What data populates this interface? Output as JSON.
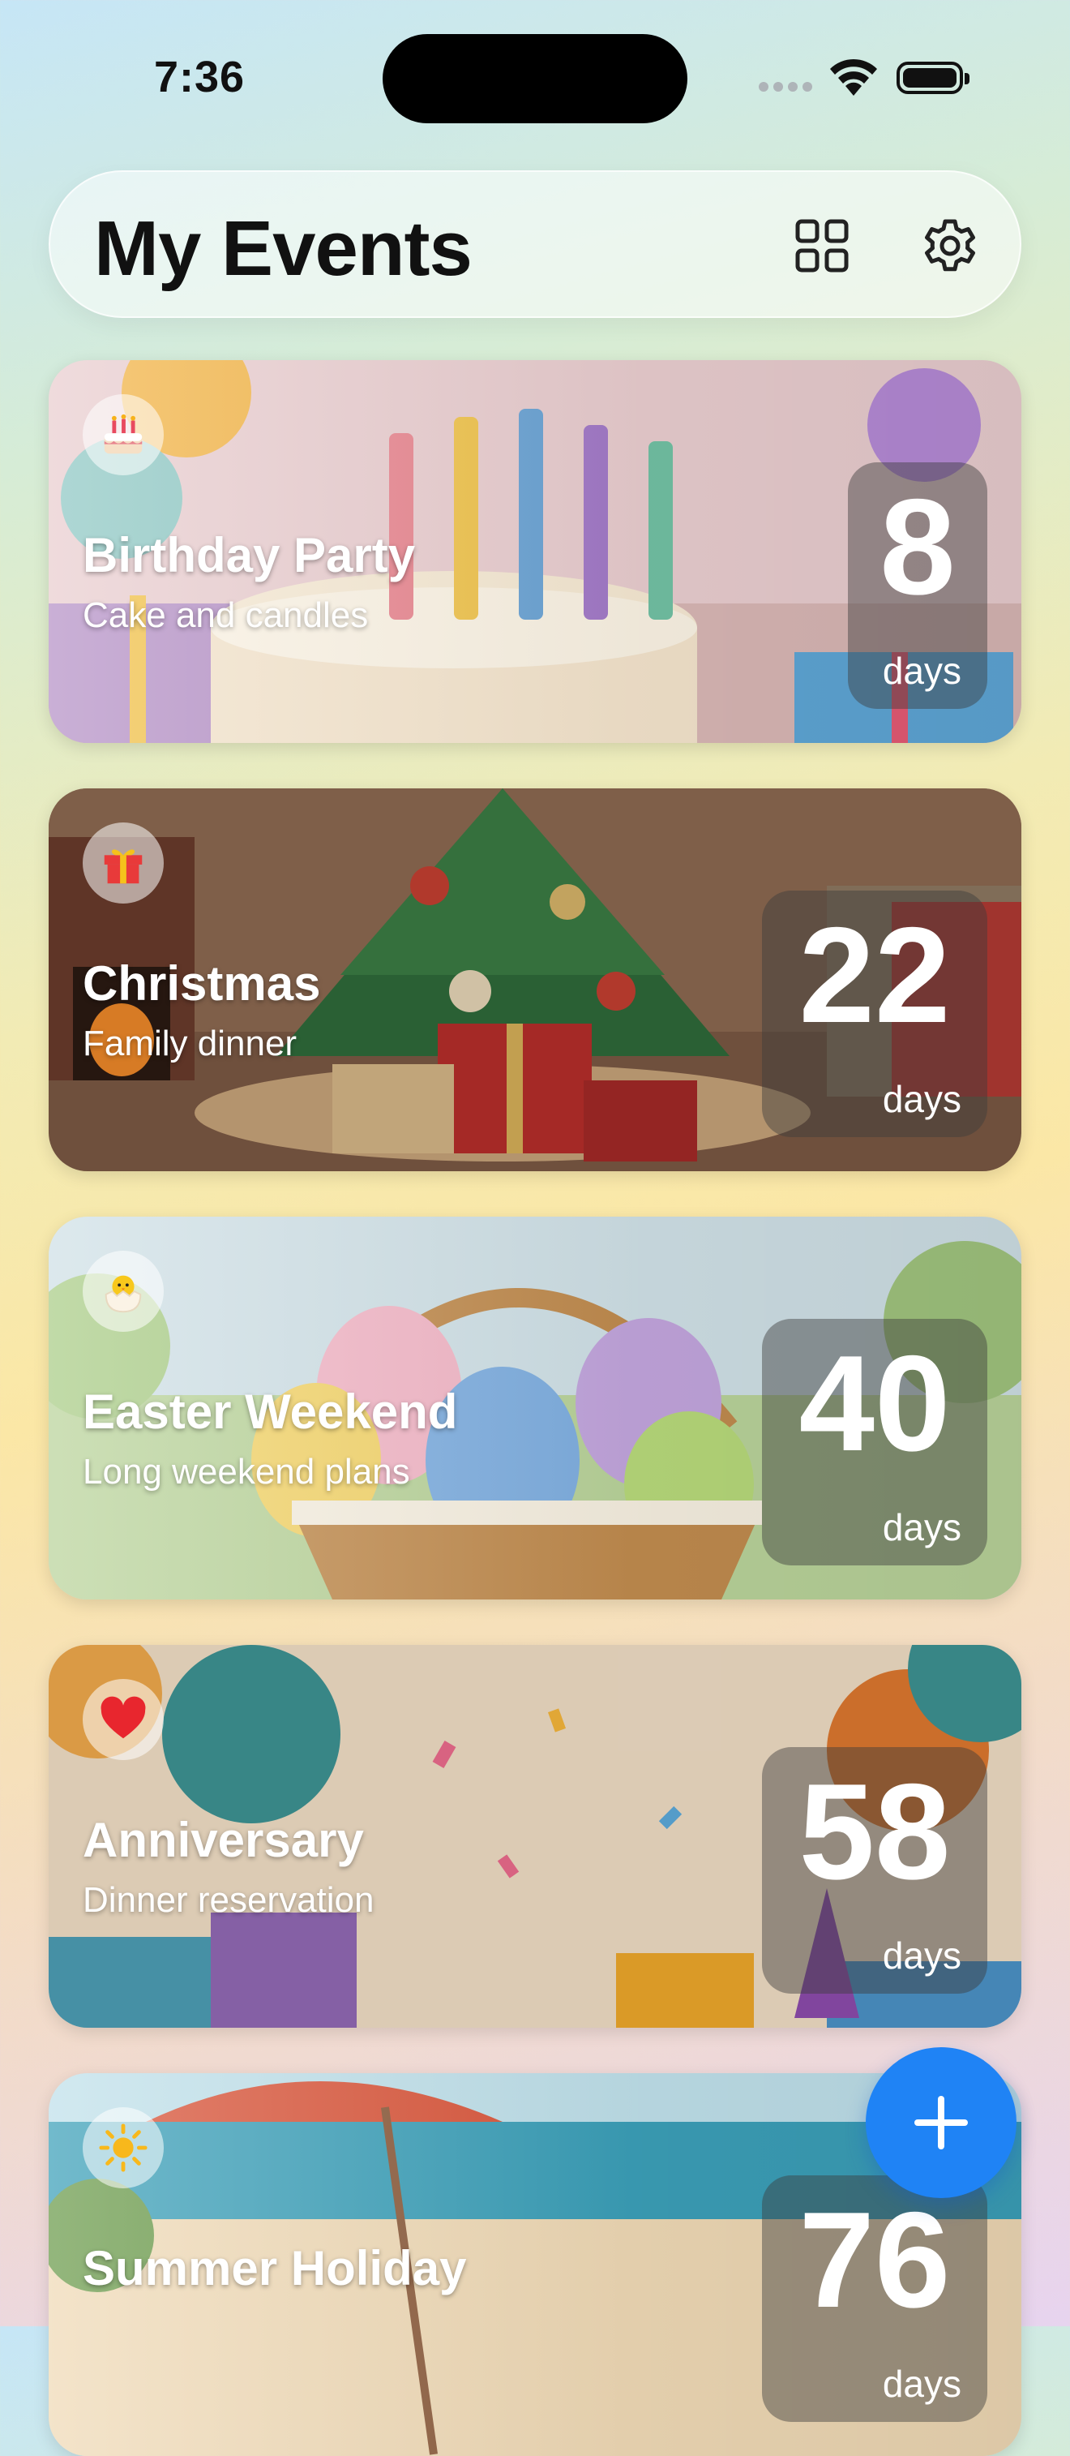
{
  "status": {
    "time": "7:36"
  },
  "header": {
    "title": "My Events",
    "grid_icon": "grid-icon",
    "settings_icon": "gear-icon"
  },
  "events": [
    {
      "emoji": "birthday-cake-icon",
      "title": "Birthday Party",
      "subtitle": "Cake and candles",
      "days": "8",
      "unit": "days"
    },
    {
      "emoji": "gift-icon",
      "title": "Christmas",
      "subtitle": "Family dinner",
      "days": "22",
      "unit": "days"
    },
    {
      "emoji": "hatching-chick-icon",
      "title": "Easter Weekend",
      "subtitle": "Long weekend plans",
      "days": "40",
      "unit": "days"
    },
    {
      "emoji": "red-heart-icon",
      "title": "Anniversary",
      "subtitle": "Dinner reservation",
      "days": "58",
      "unit": "days"
    },
    {
      "emoji": "sun-icon",
      "title": "Summer Holiday",
      "subtitle": "",
      "days": "76",
      "unit": "days"
    }
  ],
  "fab": {
    "icon": "plus-icon"
  },
  "colors": {
    "accent": "#1f83f5"
  }
}
